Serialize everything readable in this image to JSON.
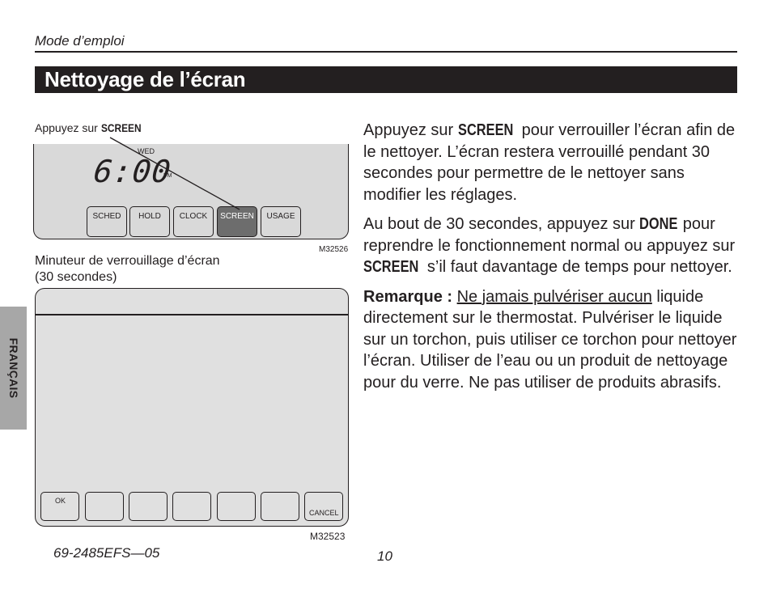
{
  "header": {
    "running_head": "Mode d’emploi",
    "title": "Nettoyage de l’écran"
  },
  "side_tab": {
    "label": "FRANÇAIS",
    "color": "#a7a7a7"
  },
  "figure1": {
    "caption_prefix": "Appuyez sur ",
    "caption_keyword": "SCREEN",
    "display": {
      "day": "WED",
      "time": "6:00",
      "ampm": "PM"
    },
    "buttons": [
      "SCHED",
      "HOLD",
      "CLOCK",
      "SCREEN",
      "USAGE"
    ],
    "active_button": "SCREEN",
    "figure_id": "M32526"
  },
  "figure2": {
    "caption_line1": "Minuteur de verrouillage d’écran",
    "caption_line2": "(30 secondes)",
    "buttons": [
      "OK",
      "",
      "",
      "",
      "",
      "",
      "CANCEL"
    ],
    "figure_id": "M32523"
  },
  "body": {
    "p1": {
      "a": "Appuyez sur ",
      "kw": "SCREEN",
      "b": " pour verrouiller l’écran afin de le nettoyer. L’écran restera verrouillé pendant 30 secondes pour permettre de le nettoyer sans modifier les réglages."
    },
    "p2": {
      "a": "Au bout de 30 secondes, appuyez sur ",
      "kw1": "DONE",
      "b": " pour reprendre le fonctionnement normal ou appuyez sur ",
      "kw2": "SCREEN",
      "c": " s’il faut davantage de temps pour nettoyer."
    },
    "p3": {
      "label": "Remarque : ",
      "underlined": "Ne jamais pulvériser aucun",
      "rest": " liquide directement sur le thermostat. Pulvériser le liquide sur un torchon, puis utiliser ce torchon pour nettoyer l’écran. Utiliser de l’eau ou un produit de nettoyage pour du verre. Ne pas utiliser de produits abrasifs."
    }
  },
  "footer": {
    "doc_code": "69-2485EFS—05",
    "page_number": "10"
  }
}
